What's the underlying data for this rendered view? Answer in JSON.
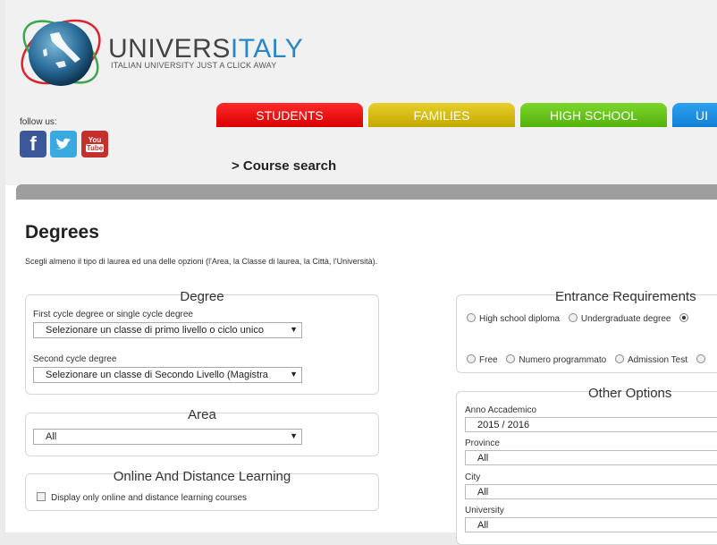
{
  "header": {
    "brand_prefix": "UNIVERS",
    "brand_highlight": "ITALY",
    "tagline": "ITALIAN UNIVERSITY JUST A CLICK AWAY",
    "follow_label": "follow us:",
    "social": {
      "facebook": "f",
      "youtube_top": "You",
      "youtube_bottom": "Tube"
    },
    "colors": {
      "brand_blue": "#2b86c8"
    }
  },
  "tabs": [
    {
      "label": "STUDENTS",
      "color": "#ff2a2a"
    },
    {
      "label": "FAMILIES",
      "color": "#e7cf2a"
    },
    {
      "label": "HIGH SCHOOL",
      "color": "#7cd62c"
    },
    {
      "label": "UI",
      "color": "#2ea1f2"
    }
  ],
  "breadcrumb": "> Course search",
  "main": {
    "title": "Degrees",
    "intro": "Scegli almeno il tipo di laurea ed una delle opzioni (l'Area, la Classe di laurea, la Città, l'Università)."
  },
  "degree_box": {
    "title": "Degree",
    "first_label": "First cycle degree or single cycle degree",
    "first_value": "Selezionare un classe di primo livello o ciclo unico",
    "second_label": "Second cycle degree",
    "second_value": "Selezionare un classe di Secondo Livello (Magistra"
  },
  "area_box": {
    "title": "Area",
    "value": "All"
  },
  "online_box": {
    "title": "Online And Distance Learning",
    "checkbox_label": "Display only online and distance learning courses"
  },
  "entrance_box": {
    "title": "Entrance Requirements",
    "row1": [
      {
        "label": "High school diploma",
        "checked": false
      },
      {
        "label": "Undergraduate degree",
        "checked": false
      },
      {
        "label": "",
        "checked": true
      }
    ],
    "row2": [
      {
        "label": "Free",
        "checked": false
      },
      {
        "label": "Numero programmato",
        "checked": false
      },
      {
        "label": "Admission Test",
        "checked": false
      }
    ]
  },
  "other_box": {
    "title": "Other Options",
    "year_label": "Anno Accademico",
    "year_value": "2015 / 2016",
    "province_label": "Province",
    "province_value": "All",
    "city_label": "City",
    "city_value": "All",
    "university_label": "University",
    "university_value": "All"
  }
}
